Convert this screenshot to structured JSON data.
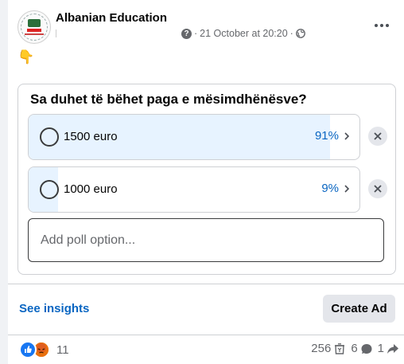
{
  "post": {
    "page_name": "Albanian Education",
    "timestamp": "21 October at 20:20",
    "audience_icon": "globe-icon",
    "emoji": "👇"
  },
  "poll": {
    "question": "Sa duhet të bëhet paga e mësimdhënësve?",
    "options": [
      {
        "label": "1500 euro",
        "percent_text": "91%",
        "percent": 91
      },
      {
        "label": "1000 euro",
        "percent_text": "9%",
        "percent": 9
      }
    ],
    "add_placeholder": "Add poll option..."
  },
  "footer": {
    "insights_label": "See insights",
    "create_ad_label": "Create Ad"
  },
  "engagement": {
    "reaction_count": "11",
    "views": "256",
    "comments": "6",
    "shares": "1"
  },
  "colors": {
    "accent": "#0a66c2",
    "poll_fill": "#e7f3ff",
    "like": "#1877f2",
    "angry": "#e9710f"
  }
}
